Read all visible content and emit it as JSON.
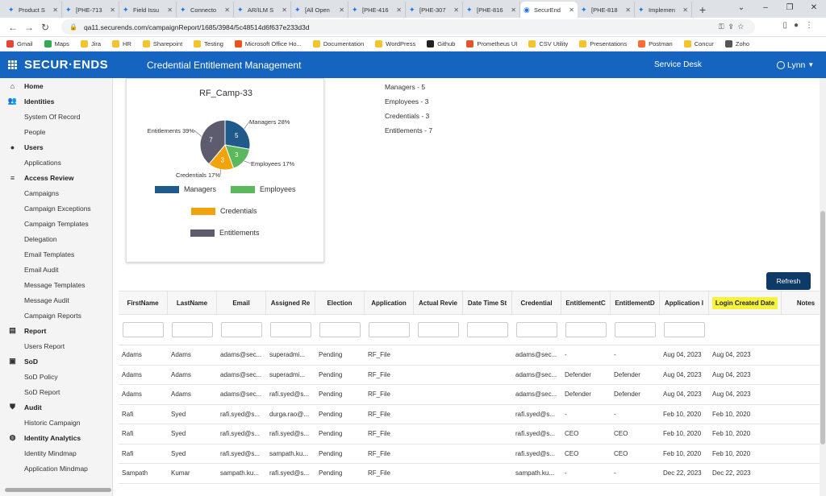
{
  "browser": {
    "tabs": [
      {
        "title": "Product S",
        "active": false
      },
      {
        "title": "[PHE-713",
        "active": false
      },
      {
        "title": "Field Issu",
        "active": false
      },
      {
        "title": "Connecto",
        "active": false
      },
      {
        "title": "AR/ILM S",
        "active": false
      },
      {
        "title": "[All Open",
        "active": false
      },
      {
        "title": "[PHE-416",
        "active": false
      },
      {
        "title": "[PHE-307",
        "active": false
      },
      {
        "title": "[PHE-816",
        "active": false
      },
      {
        "title": "SecurEnd",
        "active": true
      },
      {
        "title": "[PHE-818",
        "active": false
      },
      {
        "title": "Implemen",
        "active": false
      }
    ],
    "url": "qa11.securends.com/campaignReport/1685/3984/5c48514d6f637e233d3d",
    "bookmarks": [
      {
        "label": "Gmail",
        "color": "#ea4335"
      },
      {
        "label": "Maps",
        "color": "#34a853"
      },
      {
        "label": "Jira",
        "color": "#f4c430"
      },
      {
        "label": "HR",
        "color": "#f4c430"
      },
      {
        "label": "Sharepoint",
        "color": "#f4c430"
      },
      {
        "label": "Testing",
        "color": "#f4c430"
      },
      {
        "label": "Microsoft Office Ho...",
        "color": "#e8541c"
      },
      {
        "label": "Documentation",
        "color": "#f4c430"
      },
      {
        "label": "WordPress",
        "color": "#f4c430"
      },
      {
        "label": "Github",
        "color": "#222222"
      },
      {
        "label": "Prometheus UI",
        "color": "#e6522c"
      },
      {
        "label": "CSV Utility",
        "color": "#f4c430"
      },
      {
        "label": "Presentations",
        "color": "#f4c430"
      },
      {
        "label": "Postman",
        "color": "#ff6c37"
      },
      {
        "label": "Concur",
        "color": "#f4c430"
      },
      {
        "label": "Zoho",
        "color": "#555555"
      }
    ]
  },
  "header": {
    "logo": "SECUR·ENDS",
    "title": "Credential Entitlement Management",
    "service_desk": "Service Desk",
    "user": "Lynn",
    "color": "#1565c0"
  },
  "sidebar": {
    "items": [
      {
        "label": "Home",
        "type": "section",
        "icon": "home-icon"
      },
      {
        "label": "Identities",
        "type": "section",
        "icon": "people-icon"
      },
      {
        "label": "System Of Record",
        "type": "sub"
      },
      {
        "label": "People",
        "type": "sub"
      },
      {
        "label": "Users",
        "type": "section",
        "icon": "user-icon"
      },
      {
        "label": "Applications",
        "type": "sub"
      },
      {
        "label": "Access Review",
        "type": "section",
        "icon": "list-icon"
      },
      {
        "label": "Campaigns",
        "type": "sub"
      },
      {
        "label": "Campaign Exceptions",
        "type": "sub"
      },
      {
        "label": "Campaign Templates",
        "type": "sub"
      },
      {
        "label": "Delegation",
        "type": "sub"
      },
      {
        "label": "Email Templates",
        "type": "sub"
      },
      {
        "label": "Email Audit",
        "type": "sub"
      },
      {
        "label": "Message Templates",
        "type": "sub"
      },
      {
        "label": "Message Audit",
        "type": "sub"
      },
      {
        "label": "Campaign Reports",
        "type": "sub"
      },
      {
        "label": "Report",
        "type": "section",
        "icon": "report-icon"
      },
      {
        "label": "Users Report",
        "type": "sub"
      },
      {
        "label": "SoD",
        "type": "section",
        "icon": "sod-icon"
      },
      {
        "label": "SoD Policy",
        "type": "sub"
      },
      {
        "label": "SoD Report",
        "type": "sub"
      },
      {
        "label": "Audit",
        "type": "section",
        "icon": "shield-icon"
      },
      {
        "label": "Historic Campaign",
        "type": "sub"
      },
      {
        "label": "Identity Analytics",
        "type": "section",
        "icon": "analytics-icon"
      },
      {
        "label": "Identity Mindmap",
        "type": "sub"
      },
      {
        "label": "Application Mindmap",
        "type": "sub"
      }
    ]
  },
  "chart_data": {
    "type": "pie",
    "title": "RF_Camp-33",
    "series": [
      {
        "name": "Managers",
        "value": 5,
        "percent": "28%",
        "color": "#1f5a8a"
      },
      {
        "name": "Employees",
        "value": 3,
        "percent": "17%",
        "color": "#5cb85c"
      },
      {
        "name": "Credentials",
        "value": 3,
        "percent": "17%",
        "color": "#f0a30a"
      },
      {
        "name": "Entitlements",
        "value": 7,
        "percent": "39%",
        "color": "#5c5c6e"
      }
    ],
    "legend": "bottom"
  },
  "stats": [
    "Managers - 5",
    "Employees - 3",
    "Credentials - 3",
    "Entitlements - 7"
  ],
  "refresh_label": "Refresh",
  "table": {
    "columns": [
      "FirstName",
      "LastName",
      "Email",
      "Assigned Re",
      "Election",
      "Application",
      "Actual Revie",
      "Date Time St",
      "Credential",
      "EntitlementC",
      "EntitlementD",
      "Application I",
      "Login Created Date",
      "Notes"
    ],
    "highlight_column": 12,
    "rows": [
      [
        "Adams",
        "Adams",
        "adams@sec...",
        "superadmi...",
        "Pending",
        "RF_File",
        "",
        "",
        "adams@sec...",
        "-",
        "-",
        "Aug 04, 2023",
        "Aug 04, 2023",
        ""
      ],
      [
        "Adams",
        "Adams",
        "adams@sec...",
        "superadmi...",
        "Pending",
        "RF_File",
        "",
        "",
        "adams@sec...",
        "Defender",
        "Defender",
        "Aug 04, 2023",
        "Aug 04, 2023",
        ""
      ],
      [
        "Adams",
        "Adams",
        "adams@sec...",
        "rafi.syed@s...",
        "Pending",
        "RF_File",
        "",
        "",
        "adams@sec...",
        "Defender",
        "Defender",
        "Aug 04, 2023",
        "Aug 04, 2023",
        ""
      ],
      [
        "Rafi",
        "Syed",
        "rafi.syed@s...",
        "durga.rao@...",
        "Pending",
        "RF_File",
        "",
        "",
        "rafi.syed@s...",
        "-",
        "-",
        "Feb 10, 2020",
        "Feb 10, 2020",
        ""
      ],
      [
        "Rafi",
        "Syed",
        "rafi.syed@s...",
        "rafi.syed@s...",
        "Pending",
        "RF_File",
        "",
        "",
        "rafi.syed@s...",
        "CEO",
        "CEO",
        "Feb 10, 2020",
        "Feb 10, 2020",
        ""
      ],
      [
        "Rafi",
        "Syed",
        "rafi.syed@s...",
        "sampath.ku...",
        "Pending",
        "RF_File",
        "",
        "",
        "rafi.syed@s...",
        "CEO",
        "CEO",
        "Feb 10, 2020",
        "Feb 10, 2020",
        ""
      ],
      [
        "Sampath",
        "Kumar",
        "sampath.ku...",
        "rafi.syed@s...",
        "Pending",
        "RF_File",
        "",
        "",
        "sampath.ku...",
        "-",
        "-",
        "Dec 22, 2023",
        "Dec 22, 2023",
        ""
      ]
    ]
  }
}
